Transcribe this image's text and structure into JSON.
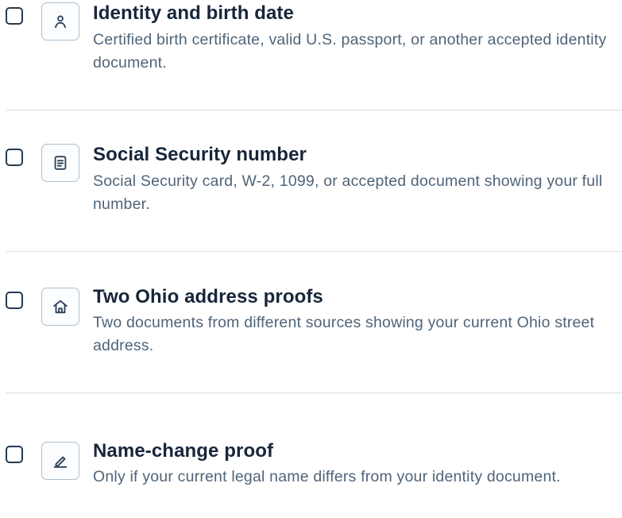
{
  "checklist": {
    "items": [
      {
        "title": "Identity and birth date",
        "description": "Certified birth certificate, valid U.S. passport, or another accepted identity document.",
        "icon": "person-icon",
        "checked": false
      },
      {
        "title": "Social Security number",
        "description": "Social Security card, W-2, 1099, or accepted document showing your full number.",
        "icon": "document-icon",
        "checked": false
      },
      {
        "title": "Two Ohio address proofs",
        "description": "Two documents from different sources showing your current Ohio street address.",
        "icon": "home-icon",
        "checked": false
      },
      {
        "title": "Name-change proof",
        "description": "Only if your current legal name differs from your identity document.",
        "icon": "pencil-icon",
        "checked": false
      }
    ]
  },
  "colors": {
    "checkbox_border": "#253a51",
    "icon_border": "#a9bfcf",
    "icon_stroke": "#2a3f57",
    "title": "#17263a",
    "description": "#4f6478",
    "divider": "#d7e0e7"
  }
}
